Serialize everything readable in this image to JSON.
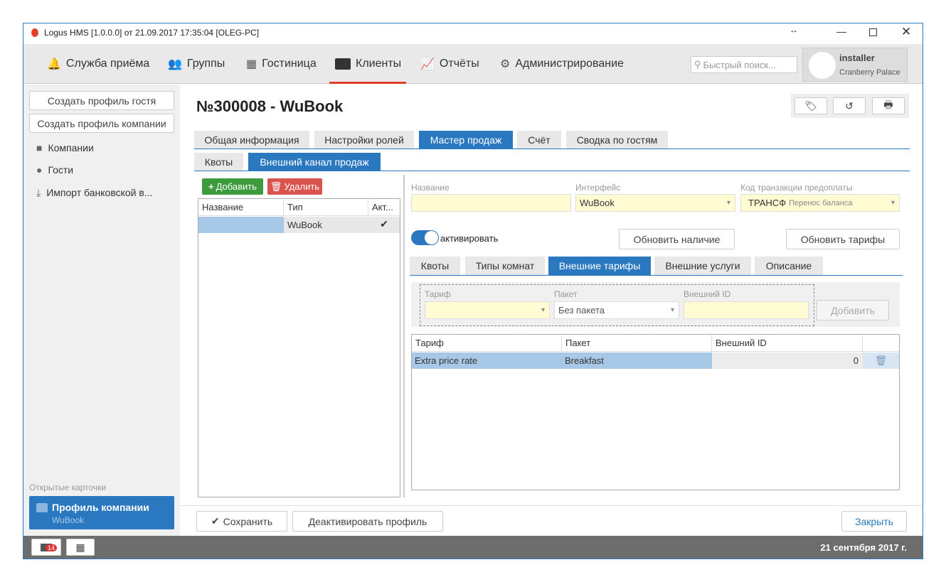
{
  "window": {
    "title": "Logus HMS [1.0.0.0] от 21.09.2017 17:35:04 [OLEG-PC]"
  },
  "nav": {
    "items": [
      {
        "label": "Служба приёма"
      },
      {
        "label": "Группы"
      },
      {
        "label": "Гостиница"
      },
      {
        "label": "Клиенты"
      },
      {
        "label": "Отчёты"
      },
      {
        "label": "Администрирование"
      }
    ],
    "search_placeholder": "Быстрый поиск...",
    "user": {
      "name": "installer",
      "hotel": "Cranberry Palace"
    }
  },
  "sidebar": {
    "create_guest": "Создать профиль гостя",
    "create_company": "Создать профиль компании",
    "items": [
      {
        "label": "Компании"
      },
      {
        "label": "Гости"
      },
      {
        "label": "Импорт банковской в..."
      }
    ],
    "open_cards_label": "Открытые карточки",
    "card": {
      "title": "Профиль компании",
      "subtitle": "WuBook"
    }
  },
  "page": {
    "title": "№300008 - WuBook",
    "tabs": [
      {
        "label": "Общая информация"
      },
      {
        "label": "Настройки ролей"
      },
      {
        "label": "Мастер продаж"
      },
      {
        "label": "Счёт"
      },
      {
        "label": "Сводка по гостям"
      }
    ],
    "subtabs": [
      {
        "label": "Квоты"
      },
      {
        "label": "Внешний канал продаж"
      }
    ]
  },
  "channels": {
    "add": "Добавить",
    "delete": "Удалить",
    "headers": [
      "Название",
      "Тип",
      "Акт..."
    ],
    "rows": [
      {
        "name": "",
        "type": "WuBook",
        "active": true
      }
    ]
  },
  "form": {
    "name_label": "Название",
    "name_value": "",
    "interface_label": "Интерфейс",
    "interface_value": "WuBook",
    "code_label": "Код транзакции предоплаты",
    "code_value": "ТРАНСФ",
    "code_desc": "Перенос баланса",
    "toggle_label": "активировать",
    "update_avail": "Обновить наличие",
    "update_rates": "Обновить тарифы"
  },
  "inner_tabs": [
    {
      "label": "Квоты"
    },
    {
      "label": "Типы комнат"
    },
    {
      "label": "Внешние тарифы"
    },
    {
      "label": "Внешние услуги"
    },
    {
      "label": "Описание"
    }
  ],
  "filter": {
    "rate_label": "Тариф",
    "rate_value": "",
    "package_label": "Пакет",
    "package_value": "Без пакета",
    "extid_label": "Внешний ID",
    "extid_value": "",
    "add": "Добавить"
  },
  "grid": {
    "headers": [
      "Тариф",
      "Пакет",
      "Внешний ID"
    ],
    "rows": [
      {
        "rate": "Extra price rate",
        "package": "Breakfast",
        "ext_id": "0"
      }
    ]
  },
  "footer": {
    "save": "Сохранить",
    "deactivate": "Деактивировать профиль",
    "close": "Закрыть"
  },
  "status": {
    "mail_count": "14",
    "date": "21 сентября 2017 г."
  }
}
